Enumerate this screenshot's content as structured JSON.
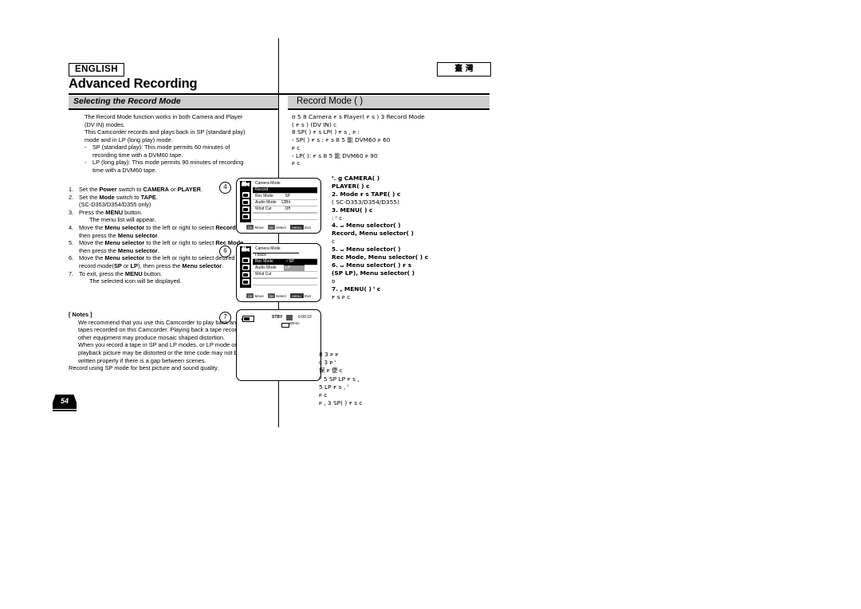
{
  "document": {
    "language_badge": "ENGLISH",
    "region_badge": "臺 灣",
    "chapter_title": "Advanced Recording",
    "page_number": "54"
  },
  "left_column": {
    "section_title": "Selecting the Record Mode",
    "intro": [
      "The Record Mode function works in both Camera and Player (DV IN) modes.",
      "This Camcorder records and plays back in SP (standard play) mode and in LP (long play) mode."
    ],
    "bullets": [
      "SP (standard play): This mode permits 60 minutes of recording time with a DVM60 tape.",
      "LP (long play): This mode permits 90 minutes of recording time with a DVM60 tape."
    ],
    "steps": [
      {
        "n": "1.",
        "text": "Set the Power switch to CAMERA or PLAYER."
      },
      {
        "n": "2.",
        "text": "Set the Mode switch to TAPE."
      },
      {
        "n": "2b",
        "text": "(SC-D353/D354/D355 only)"
      },
      {
        "n": "3.",
        "text": "Press the MENU button."
      },
      {
        "n": "3b",
        "text": "The menu list will appear."
      },
      {
        "n": "4.",
        "text": "Move the Menu selector to the left or right to select Record, then press the Menu selector."
      },
      {
        "n": "5.",
        "text": "Move the Menu selector to the left or right to select Rec Mode, then press the Menu selector."
      },
      {
        "n": "6.",
        "text": "Move the Menu selector to the left or right to select desired record mode(SP or LP), then press the Menu selector."
      },
      {
        "n": "7.",
        "text": "To exit, press the MENU button."
      },
      {
        "n": "7b",
        "text": "The selected icon will be displayed."
      }
    ],
    "notes_header": "[ Notes ]",
    "notes": [
      "We recommend that you use this Camcorder to play back any tapes recorded on this Camcorder. Playing back a tape recorded in other equipment may produce mosaic shaped distortion.",
      "When you record a tape in SP and LP modes, or LP mode only, the playback picture may be distorted or the time code may not be written properly if there is a gap between scenes.",
      "Record using SP mode for best picture and sound quality."
    ]
  },
  "right_column": {
    "section_title": "Record Mode  (             )",
    "intro_lines": [
      "ʊ  5  8 Camera      ғ s   Player(     ғ s )      3 Record Mode",
      "(        ғ s ) (DV IN) c",
      "8 SP(            ) ғ s   LP(                ) ғ s   ,      ᴘ                  :",
      "-    SP(              ) ғ s :   ғ s  8  5 能           DVM60 ᴘ          60",
      "            ᴘ            c",
      "-    LP(                ):     ғ s  8  5 能          DVM60 ᴘ          90",
      "          ᴘ         c"
    ],
    "steps": [
      "ᶦ.                 ɡ       CAMERA(           )",
      "     PLAYER(            ) c",
      "2.      Mode ғ s           TAPE(        )     c",
      "       (     SC-D353/D354/D355)",
      "3.        MENU(     )       c",
      "           :  ᶦ                c",
      "4.        ᴗ   Menu selector(                )",
      "    Record,              Menu selector(              )",
      "        c",
      "5.        ᴗ   Menu selector(                )",
      "    Rec Mode,       Menu selector(            ) c",
      "6.        ᴗ   Menu selector(                )          ғ s",
      "    (SP   LP),                Menu selector(              )",
      "        ᴅ",
      "7.             ,       MENU(    )          ᴵ c",
      "              ғ s ᴘ                   c"
    ],
    "notes_lines": [
      "            8                3               ᴘ                   ᴘ",
      "        c                            3              ᴘ                ᴵ",
      "                  保 ᴘ     便 c",
      "              ᴰ       5 SP    LP ғ s                                ,",
      "   5 LP ғ s           , ᴵ",
      "            ᴘ                       c",
      "   ᴘ                 ,      3 SP(            ) ғ s  c"
    ]
  },
  "lcd_screens": [
    {
      "marker": "4",
      "type": "menu",
      "title": "Camera Mode",
      "rows": [
        {
          "label": "Record",
          "value": "",
          "highlight": true
        },
        {
          "label": "Rec Mode",
          "value": "SP",
          "highlight": false
        },
        {
          "label": "Audio Mode",
          "value": "12Bit",
          "highlight": false
        },
        {
          "label": "Wind Cut",
          "value": "Off",
          "highlight": false
        }
      ],
      "footer": [
        {
          "key": "OK",
          "label": "Move"
        },
        {
          "key": "OK",
          "label": "Select"
        },
        {
          "key": "MENU",
          "label": "Exit"
        }
      ]
    },
    {
      "marker": "6",
      "type": "menu-popup",
      "title": "Camera Mode",
      "rows": [
        {
          "label": "t Back",
          "value": "",
          "highlight": false
        },
        {
          "label": "Rec Mode",
          "value": "",
          "highlight": true
        },
        {
          "label": "Audio Mode",
          "value": "",
          "highlight": false
        },
        {
          "label": "Wind Cut",
          "value": "",
          "highlight": false
        }
      ],
      "popup": [
        {
          "label": "✓SP",
          "state": "selected"
        },
        {
          "label": "LP",
          "state": "alt"
        }
      ],
      "footer": [
        {
          "key": "OK",
          "label": "Move"
        },
        {
          "key": "OK",
          "label": "Select"
        },
        {
          "key": "MENU",
          "label": "Exit"
        }
      ]
    },
    {
      "marker": "7",
      "type": "standby",
      "status": "STBY",
      "timecode": "0:00:10",
      "tape_remaining": "60min"
    }
  ]
}
